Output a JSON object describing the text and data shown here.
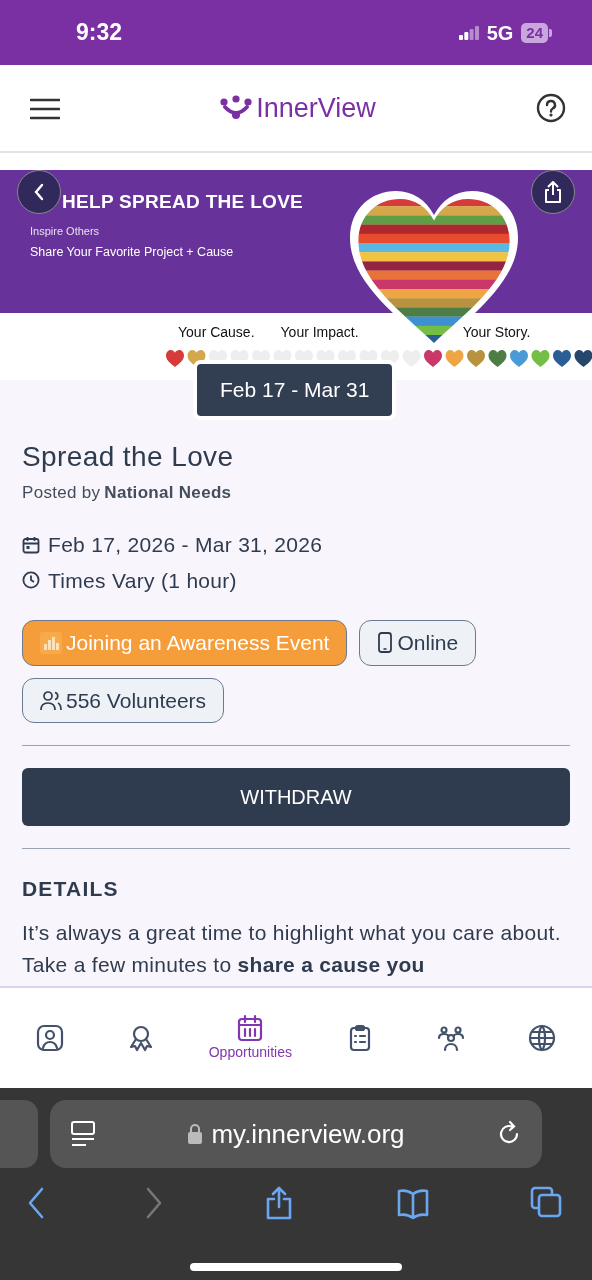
{
  "status_bar": {
    "time": "9:32",
    "network": "5G",
    "battery": "24"
  },
  "header": {
    "logo": "InnerView"
  },
  "banner": {
    "headline": "HELP SPREAD THE LOVE",
    "subtitle": "Inspire Others",
    "line": "Share Your Favorite Project + Cause",
    "taglines": [
      "Your Cause.",
      "Your Impact.",
      "Your Story."
    ],
    "date_pill": "Feb 17 - Mar 31"
  },
  "event": {
    "title": "Spread the Love",
    "posted_by": "Posted by",
    "poster": "National Needs",
    "dates": "Feb 17, 2026 - Mar 31, 2026",
    "times": "Times Vary (1 hour)",
    "chips": [
      {
        "kind": "category",
        "label": "Joining an Awareness Event"
      },
      {
        "kind": "online",
        "label": "Online"
      },
      {
        "kind": "volunteers",
        "label": "556 Volunteers"
      }
    ],
    "action": "WITHDRAW",
    "details_heading": "DETAILS",
    "details": "It’s always a great time to highlight what you care about. Take a few minutes to **share a cause you**"
  },
  "bottom_nav": [
    {
      "kind": "profile",
      "selected": false
    },
    {
      "kind": "award",
      "selected": false
    },
    {
      "kind": "calendar",
      "label": "Opportunities",
      "selected": true
    },
    {
      "kind": "clipboard",
      "selected": false
    },
    {
      "kind": "team",
      "selected": false
    },
    {
      "kind": "globe",
      "selected": false
    }
  ],
  "browser": {
    "url": "my.innerview.org"
  }
}
